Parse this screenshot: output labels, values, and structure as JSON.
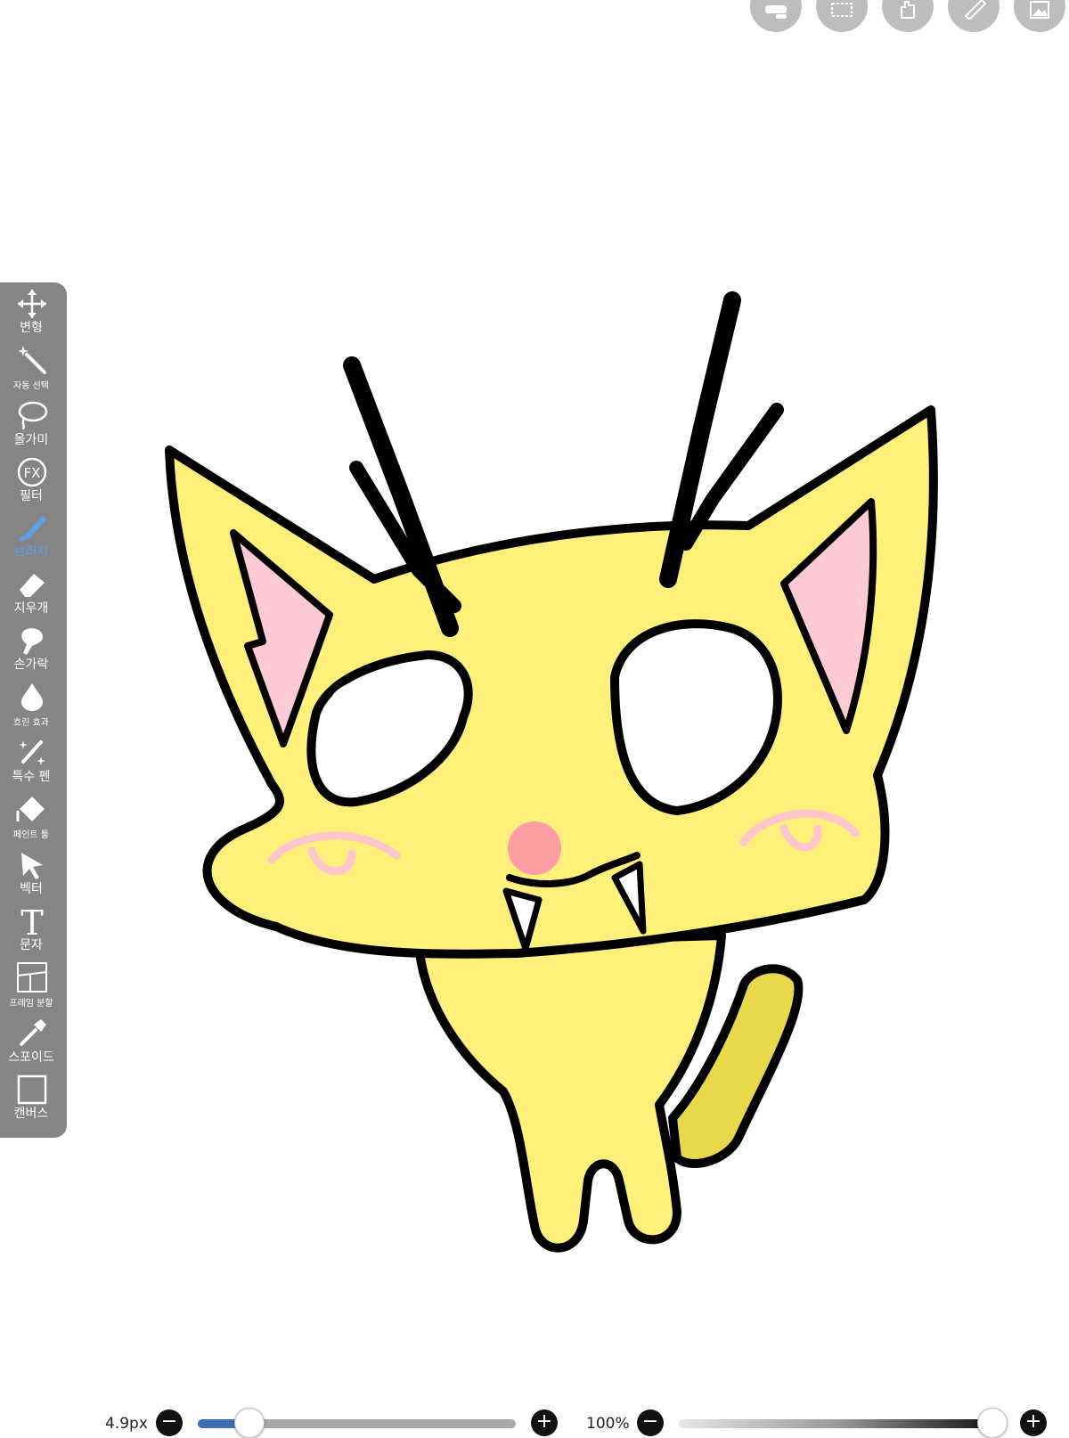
{
  "top_toolbar": {
    "buttons": [
      {
        "name": "layers-icon"
      },
      {
        "name": "selection-icon"
      },
      {
        "name": "hand-icon"
      },
      {
        "name": "ruler-icon"
      },
      {
        "name": "material-icon"
      }
    ]
  },
  "tools": [
    {
      "name": "transform",
      "label": "변형",
      "icon": "move-arrows-icon"
    },
    {
      "name": "auto-select",
      "label": "자동 선택",
      "icon": "magic-wand-icon"
    },
    {
      "name": "lasso",
      "label": "올가미",
      "icon": "lasso-icon"
    },
    {
      "name": "filter",
      "label": "필터",
      "icon": "fx-icon"
    },
    {
      "name": "brush",
      "label": "브러시",
      "icon": "brush-icon",
      "active": true
    },
    {
      "name": "eraser",
      "label": "지우개",
      "icon": "eraser-icon"
    },
    {
      "name": "finger",
      "label": "손가락",
      "icon": "finger-icon"
    },
    {
      "name": "blur",
      "label": "흐린 효과",
      "icon": "droplet-icon"
    },
    {
      "name": "special-pen",
      "label": "특수 펜",
      "icon": "sparkle-pen-icon"
    },
    {
      "name": "paint-tool",
      "label": "페인트 툴",
      "icon": "paint-bucket-icon"
    },
    {
      "name": "vector",
      "label": "벡터",
      "icon": "cursor-arrow-icon"
    },
    {
      "name": "text",
      "label": "문자",
      "icon": "text-t-icon"
    },
    {
      "name": "frame-divide",
      "label": "프레임 분할",
      "icon": "frame-divide-icon"
    },
    {
      "name": "eyedropper",
      "label": "스포이드",
      "icon": "eyedropper-icon"
    },
    {
      "name": "canvas",
      "label": "캔버스",
      "icon": "canvas-square-icon"
    }
  ],
  "brush_size": {
    "value_text": "4.9px",
    "fraction": 0.16,
    "minus": "−",
    "plus": "+"
  },
  "opacity": {
    "value_text": "100%",
    "fraction": 1.0,
    "minus": "−",
    "plus": "+"
  },
  "colors": {
    "panel": "#858585",
    "active": "#5aa0ef",
    "cat_fill": "#fff07a",
    "tail_fill": "#e8d84a",
    "ear_inner": "#ffc9d6",
    "nose": "#ff9ea2",
    "blush": "#ffc6cc"
  }
}
